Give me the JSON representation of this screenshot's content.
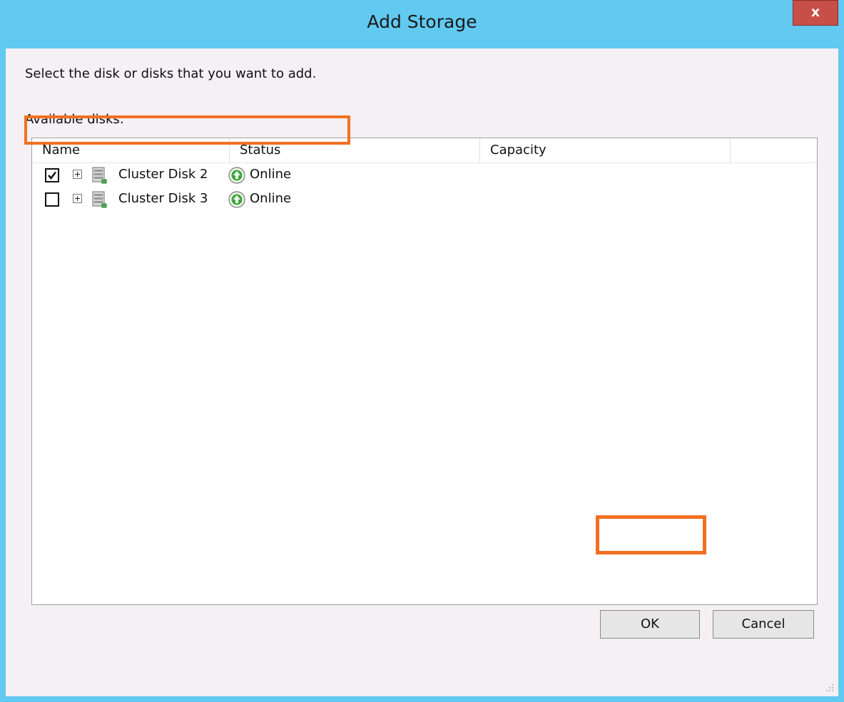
{
  "window": {
    "title": "Add Storage",
    "close_label": "x"
  },
  "instruction": "Select the disk or disks that you want to add.",
  "available_label": "Available disks:",
  "columns": [
    "Name",
    "Status",
    "Capacity"
  ],
  "disks": [
    {
      "name": "Cluster Disk 2",
      "status": "Online",
      "checked": true,
      "icon": "disk-icon",
      "status_icon": "online-arrow-icon"
    },
    {
      "name": "Cluster Disk 3",
      "status": "Online",
      "checked": false,
      "icon": "disk-icon",
      "status_icon": "online-arrow-icon"
    }
  ],
  "buttons": {
    "ok": "OK",
    "cancel": "Cancel"
  },
  "colors": {
    "titlebar": "#62c9f1",
    "close": "#c74f47",
    "highlight": "#f37021",
    "online": "#3aa935"
  }
}
